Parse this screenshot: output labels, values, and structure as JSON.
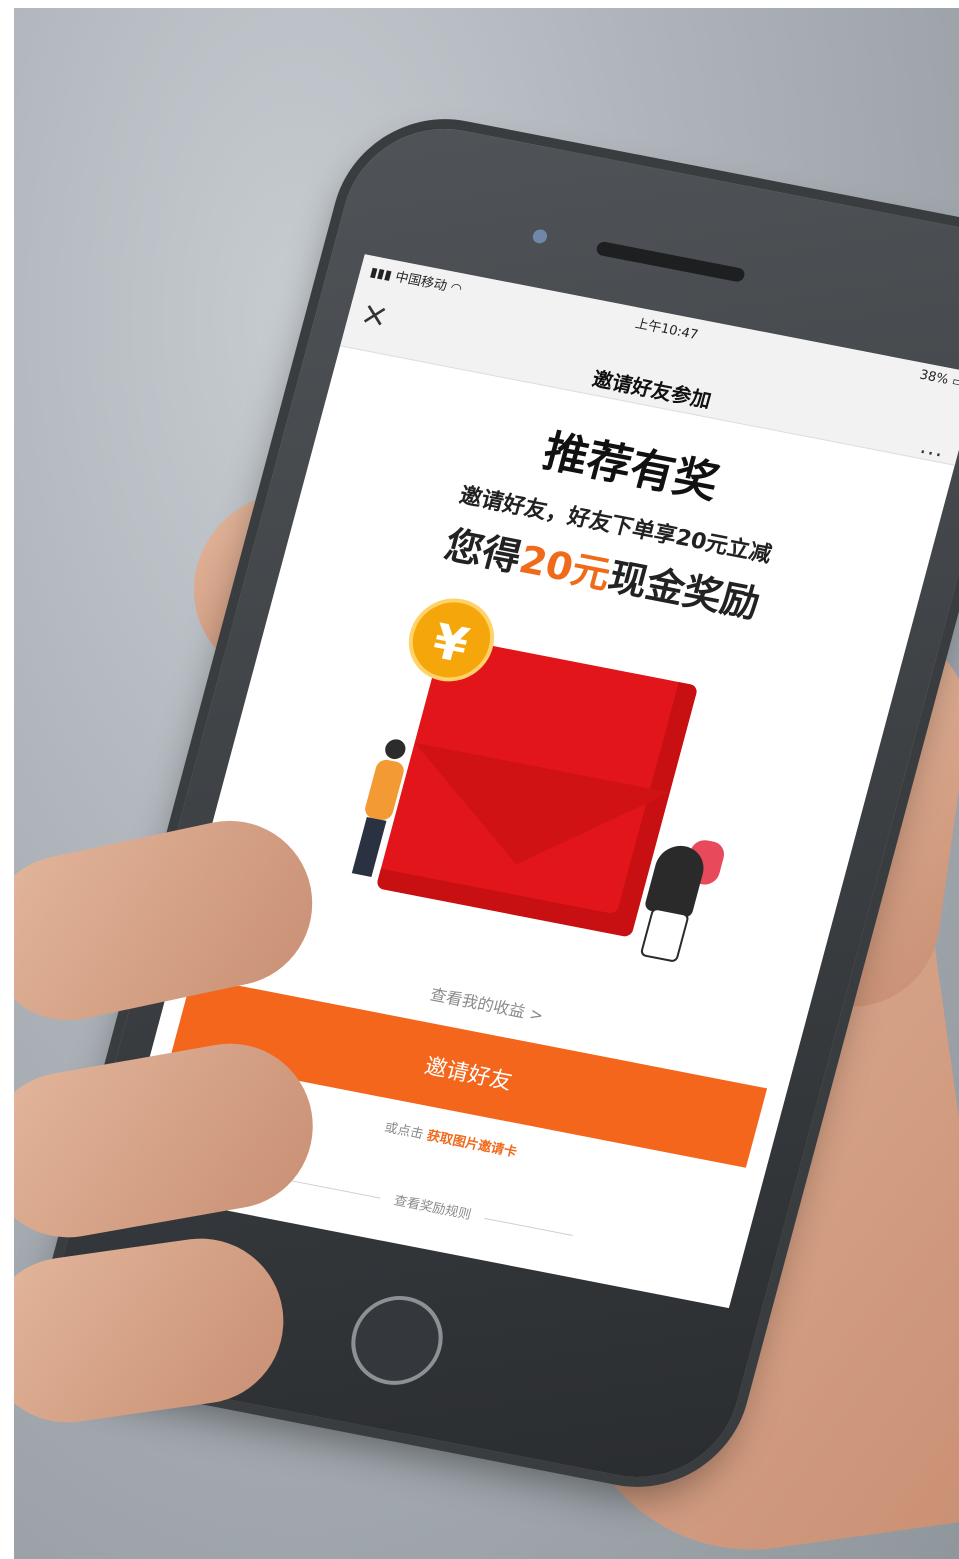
{
  "status_bar": {
    "carrier": "中国移动",
    "time": "上午10:47",
    "battery": "38%"
  },
  "nav": {
    "close_glyph": "×",
    "title": "邀请好友参加",
    "more_glyph": "···"
  },
  "hero": {
    "title": "推荐有奖",
    "desc": "邀请好友，好友下单享20元立减",
    "reward_prefix": "您得",
    "reward_amount": "20元",
    "reward_suffix": "现金奖励"
  },
  "illustration": {
    "coin_glyph": "¥"
  },
  "earnings_link": "查看我的收益 >",
  "invite_button": "邀请好友",
  "hint": {
    "prefix": "或点击",
    "link": "获取图片邀请卡"
  },
  "rules_link": "查看奖励规则",
  "colors": {
    "accent": "#f06a1b",
    "button": "#f4661b",
    "envelope": "#e2161a",
    "coin": "#f5a60a"
  },
  "icons": [
    "signal-icon",
    "wifi-icon",
    "battery-icon",
    "close-icon",
    "more-icon",
    "coin-icon",
    "chevron-right-icon"
  ]
}
